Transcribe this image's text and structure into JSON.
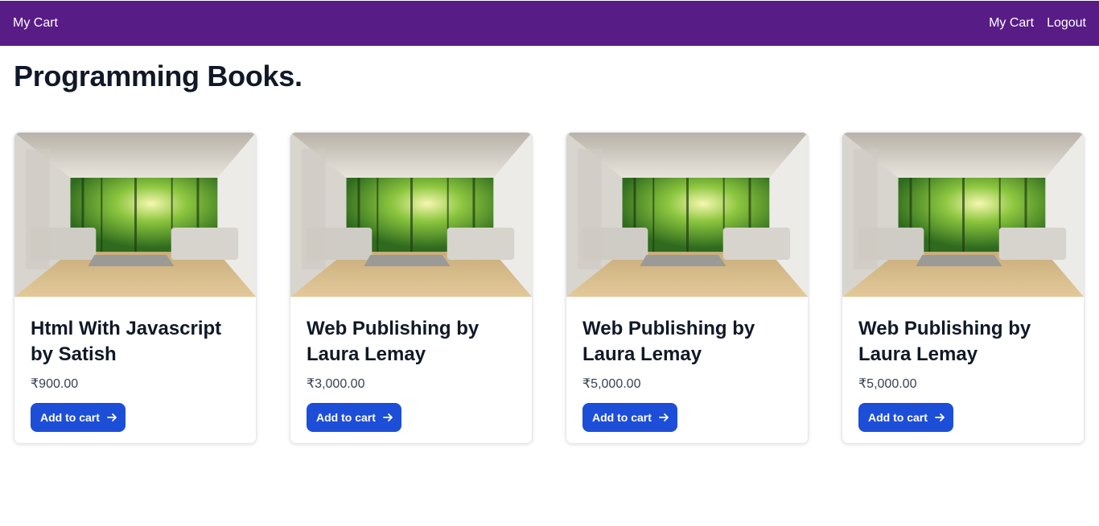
{
  "nav": {
    "brand": "My Cart",
    "links": [
      "My Cart",
      "Logout"
    ]
  },
  "page": {
    "title": "Programming Books."
  },
  "products": [
    {
      "title": "Html With Javascript by Satish",
      "price": "₹900.00",
      "button_label": "Add to cart",
      "button_icon": "arrow-right-icon"
    },
    {
      "title": "Web Publishing by Laura Lemay",
      "price": "₹3,000.00",
      "button_label": "Add to cart",
      "button_icon": "arrow-right-icon"
    },
    {
      "title": "Web Publishing by Laura Lemay",
      "price": "₹5,000.00",
      "button_label": "Add to cart",
      "button_icon": "arrow-right-icon"
    },
    {
      "title": "Web Publishing by Laura Lemay",
      "price": "₹5,000.00",
      "button_label": "Add to cart",
      "button_icon": "arrow-right-icon"
    }
  ],
  "colors": {
    "navbar": "#581c87",
    "button": "#1d4ed8",
    "title": "#111827"
  }
}
